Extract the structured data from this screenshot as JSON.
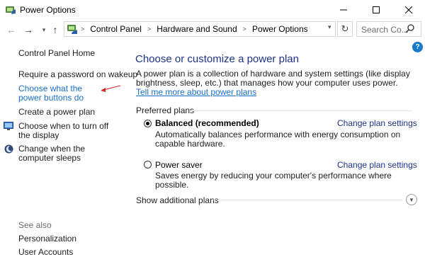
{
  "window": {
    "title": "Power Options"
  },
  "address": {
    "breadcrumbs": [
      "Control Panel",
      "Hardware and Sound",
      "Power Options"
    ],
    "search_placeholder": "Search Co..."
  },
  "sidebar": {
    "home": "Control Panel Home",
    "items": [
      "Require a password on wakeup",
      "Choose what the power buttons do",
      "Create a power plan",
      "Choose when to turn off the display",
      "Change when the computer sleeps"
    ],
    "see_also_label": "See also",
    "see_also": [
      "Personalization",
      "User Accounts"
    ]
  },
  "main": {
    "title": "Choose or customize a power plan",
    "description": "A power plan is a collection of hardware and system settings (like display brightness, sleep, etc.) that manages how your computer uses power.",
    "description_link": "Tell me more about power plans",
    "preferred_label": "Preferred plans",
    "plans": [
      {
        "name": "Balanced (recommended)",
        "selected": true,
        "change": "Change plan settings",
        "description": "Automatically balances performance with energy consumption on capable hardware."
      },
      {
        "name": "Power saver",
        "selected": false,
        "change": "Change plan settings",
        "description": "Saves energy by reducing your computer's performance where possible."
      }
    ],
    "show_additional": "Show additional plans"
  },
  "colors": {
    "link": "#1e3287",
    "hover_link": "#1a6fc5",
    "accent": "#1979ca",
    "annotation_arrow": "#e02020"
  }
}
